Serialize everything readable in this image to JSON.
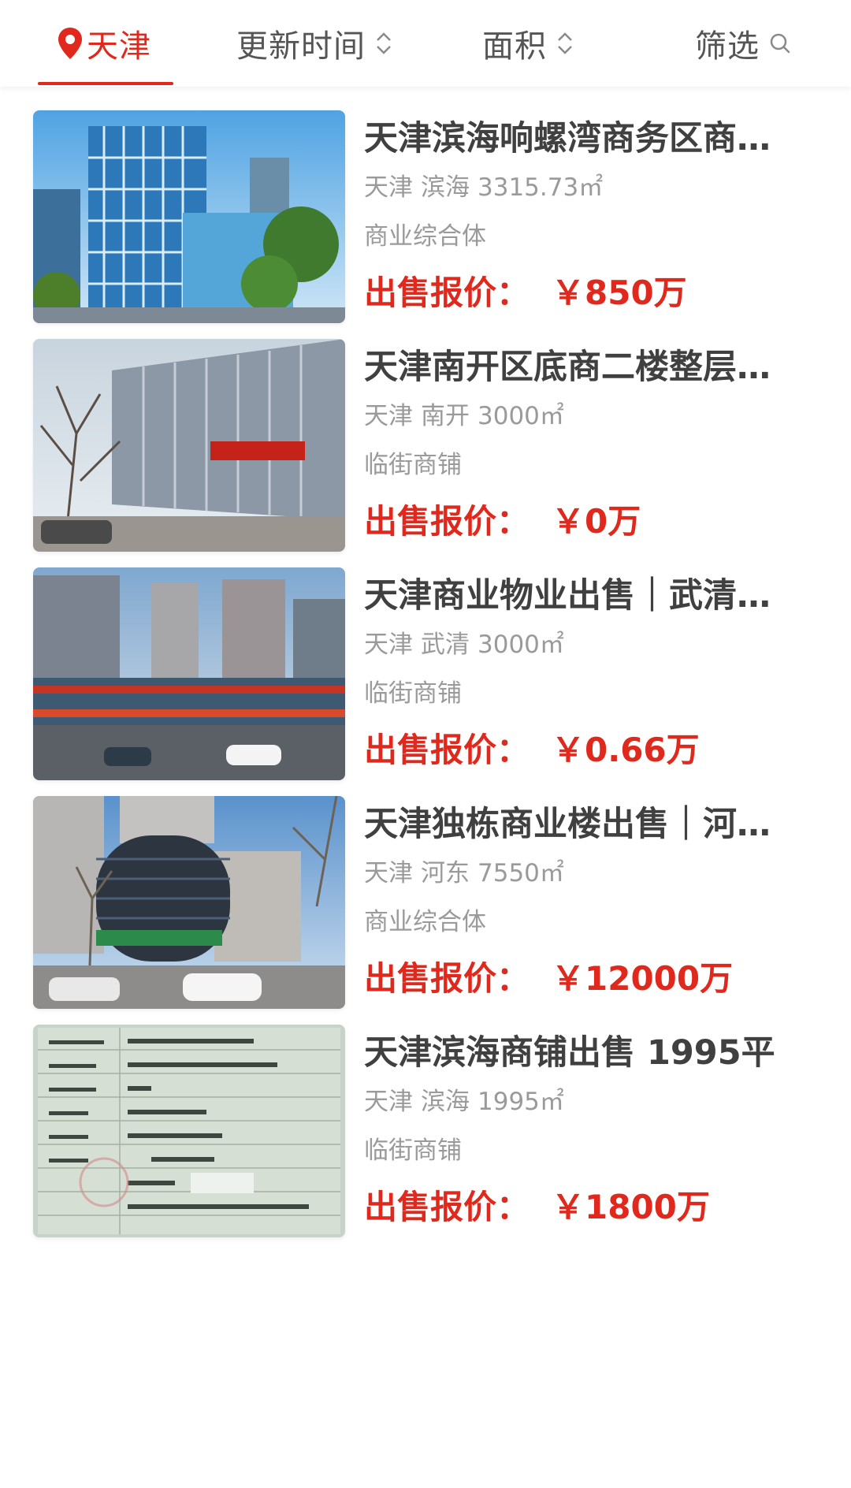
{
  "filter_bar": {
    "city": "天津",
    "update_time": "更新时间",
    "area": "面积",
    "filter": "筛选"
  },
  "accent_color": "#e0281d",
  "listings": [
    {
      "title": "天津滨海响螺湾商务区商…",
      "city": "天津",
      "district": "滨海",
      "area": "3315.73㎡",
      "category": "商业综合体",
      "price_label": "出售报价：",
      "price_value": "￥850万"
    },
    {
      "title": "天津南开区底商二楼整层…",
      "city": "天津",
      "district": "南开",
      "area": "3000㎡",
      "category": "临街商铺",
      "price_label": "出售报价：",
      "price_value": "￥0万"
    },
    {
      "title": "天津商业物业出售｜武清…",
      "city": "天津",
      "district": "武清",
      "area": "3000㎡",
      "category": "临街商铺",
      "price_label": "出售报价：",
      "price_value": "￥0.66万"
    },
    {
      "title": "天津独栋商业楼出售｜河…",
      "city": "天津",
      "district": "河东",
      "area": "7550㎡",
      "category": "商业综合体",
      "price_label": "出售报价：",
      "price_value": "￥12000万"
    },
    {
      "title": "天津滨海商铺出售 1995平",
      "city": "天津",
      "district": "滨海",
      "area": "1995㎡",
      "category": "临街商铺",
      "price_label": "出售报价：",
      "price_value": "￥1800万"
    }
  ]
}
